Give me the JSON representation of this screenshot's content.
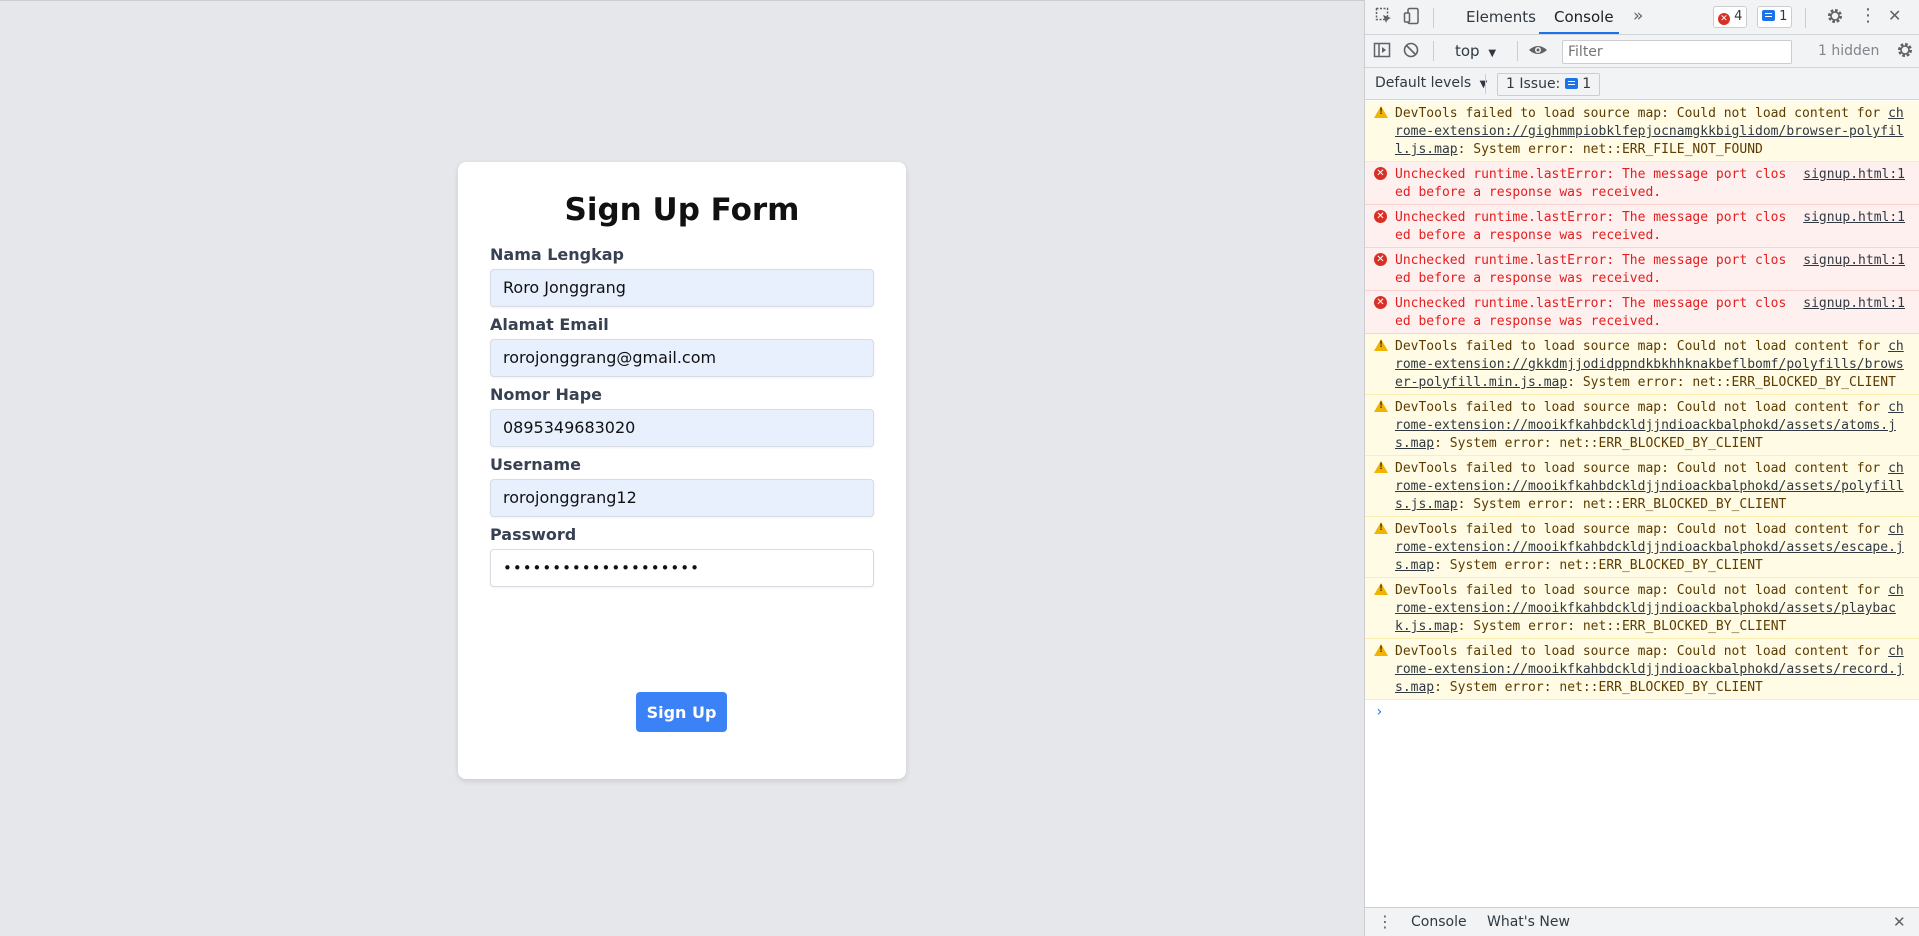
{
  "form": {
    "title": "Sign Up Form",
    "fields": [
      {
        "label": "Nama Lengkap",
        "value": "Roro Jonggrang"
      },
      {
        "label": "Alamat Email",
        "value": "rorojonggrang@gmail.com"
      },
      {
        "label": "Nomor Hape",
        "value": "0895349683020"
      },
      {
        "label": "Username",
        "value": "rorojonggrang12"
      },
      {
        "label": "Password",
        "value": "••••••••••••••••••••"
      }
    ],
    "submit_label": "Sign Up",
    "accent": "#3b82f6"
  },
  "devtools": {
    "tabs": [
      "Elements",
      "Console"
    ],
    "active_tab": "Console",
    "more_tabs_icon": "chevron-double-right-icon",
    "error_count": "4",
    "message_count": "1",
    "context": "top",
    "filter_placeholder": "Filter",
    "hidden_count": "1 hidden",
    "levels": "Default levels",
    "issues_label": "1 Issue:",
    "issues_count": "1",
    "messages": [
      {
        "level": "warning",
        "text": "DevTools failed to load source map: Could not load content for ",
        "link": "chrome-extension://gighmmpiobklfepjocnamgkkbiglidom/browser-polyfill.js.map",
        "tail": ": System error: net::ERR_FILE_NOT_FOUND"
      },
      {
        "level": "error",
        "text": "Unchecked runtime.lastError: The message port closed before a response was received.",
        "source": "signup.html:1"
      },
      {
        "level": "error",
        "text": "Unchecked runtime.lastError: The message port closed before a response was received.",
        "source": "signup.html:1"
      },
      {
        "level": "error",
        "text": "Unchecked runtime.lastError: The message port closed before a response was received.",
        "source": "signup.html:1"
      },
      {
        "level": "error",
        "text": "Unchecked runtime.lastError: The message port closed before a response was received.",
        "source": "signup.html:1"
      },
      {
        "level": "warning",
        "text": "DevTools failed to load source map: Could not load content for ",
        "link": "chrome-extension://gkkdmjjodidppndkbkhhknakbeflbomf/polyfills/browser-polyfill.min.js.map",
        "tail": ": System error: net::ERR_BLOCKED_BY_CLIENT"
      },
      {
        "level": "warning",
        "text": "DevTools failed to load source map: Could not load content for ",
        "link": "chrome-extension://mooikfkahbdckldjjndioackbalphokd/assets/atoms.js.map",
        "tail": ": System error: net::ERR_BLOCKED_BY_CLIENT"
      },
      {
        "level": "warning",
        "text": "DevTools failed to load source map: Could not load content for ",
        "link": "chrome-extension://mooikfkahbdckldjjndioackbalphokd/assets/polyfills.js.map",
        "tail": ": System error: net::ERR_BLOCKED_BY_CLIENT"
      },
      {
        "level": "warning",
        "text": "DevTools failed to load source map: Could not load content for ",
        "link": "chrome-extension://mooikfkahbdckldjjndioackbalphokd/assets/escape.js.map",
        "tail": ": System error: net::ERR_BLOCKED_BY_CLIENT"
      },
      {
        "level": "warning",
        "text": "DevTools failed to load source map: Could not load content for ",
        "link": "chrome-extension://mooikfkahbdckldjjndioackbalphokd/assets/playback.js.map",
        "tail": ": System error: net::ERR_BLOCKED_BY_CLIENT"
      },
      {
        "level": "warning",
        "text": "DevTools failed to load source map: Could not load content for ",
        "link": "chrome-extension://mooikfkahbdckldjjndioackbalphokd/assets/record.js.map",
        "tail": ": System error: net::ERR_BLOCKED_BY_CLIENT"
      }
    ],
    "prompt_symbol": "›",
    "drawer_tabs": [
      "Console",
      "What's New"
    ]
  }
}
